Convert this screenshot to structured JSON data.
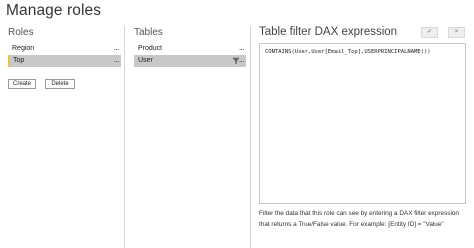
{
  "dialog": {
    "title": "Manage roles"
  },
  "roles": {
    "header": "Roles",
    "items": [
      {
        "label": "Region",
        "more": "..."
      },
      {
        "label": "Top",
        "more": "..."
      }
    ],
    "create_label": "Create",
    "delete_label": "Delete"
  },
  "tables": {
    "header": "Tables",
    "items": [
      {
        "label": "Product",
        "more": "..."
      },
      {
        "label": "User",
        "more": "..."
      }
    ]
  },
  "dax": {
    "header": "Table filter DAX expression",
    "confirm_glyph": "✓",
    "cancel_glyph": "×",
    "expression": "CONTAINS(User,User[Email_Top],USERPRINCIPALNAME())",
    "help_text": "Filter the data that this role can see by entering a DAX filter expression that returns a True/False value. For example: [Entity ID] = \"Value\""
  },
  "colors": {
    "selected_row": "#c8c8c8",
    "selection_marker": "#e8c547",
    "divider": "#d6d6d6"
  }
}
